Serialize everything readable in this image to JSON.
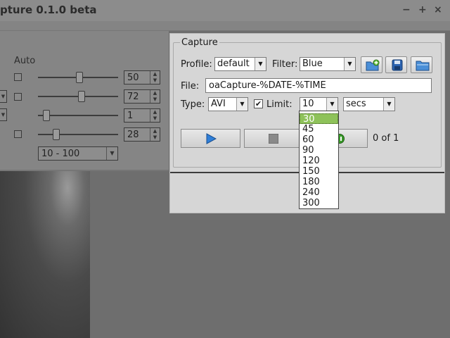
{
  "window": {
    "title": "pture 0.1.0 beta",
    "controls": [
      "−",
      "+",
      "×"
    ]
  },
  "controls_panel": {
    "auto_label": "Auto",
    "rows": [
      {
        "value": "50",
        "auto_checkbox": true,
        "slider_fraction": 0.5
      },
      {
        "value": "72",
        "auto_checkbox": true,
        "slider_fraction": 0.54
      },
      {
        "value": "1",
        "auto_checkbox": false,
        "slider_fraction": 0.06
      },
      {
        "value": "28",
        "auto_checkbox": true,
        "slider_fraction": 0.2
      }
    ],
    "range_select": "10 - 100"
  },
  "capture": {
    "group_title": "Capture",
    "profile_label": "Profile:",
    "profile_value": "default",
    "filter_label": "Filter:",
    "filter_value": "Blue",
    "toolbar_icons": [
      "new-folder-icon",
      "save-disk-icon",
      "open-folder-icon"
    ],
    "file_label": "File:",
    "file_value": "oaCapture-%DATE-%TIME",
    "type_label": "Type:",
    "type_value": "AVI",
    "limit_label": "Limit:",
    "limit_checked": true,
    "limit_value": "10",
    "unit_value": "secs",
    "progress_text": "0 of 1",
    "dropdown_options": [
      "30",
      "45",
      "60",
      "90",
      "120",
      "150",
      "180",
      "240",
      "300"
    ],
    "dropdown_selected": "30"
  },
  "colors": {
    "selection": "#8ec25a",
    "play_icon": "#2f7fd8",
    "dock_bg": "#d6d6d6"
  }
}
